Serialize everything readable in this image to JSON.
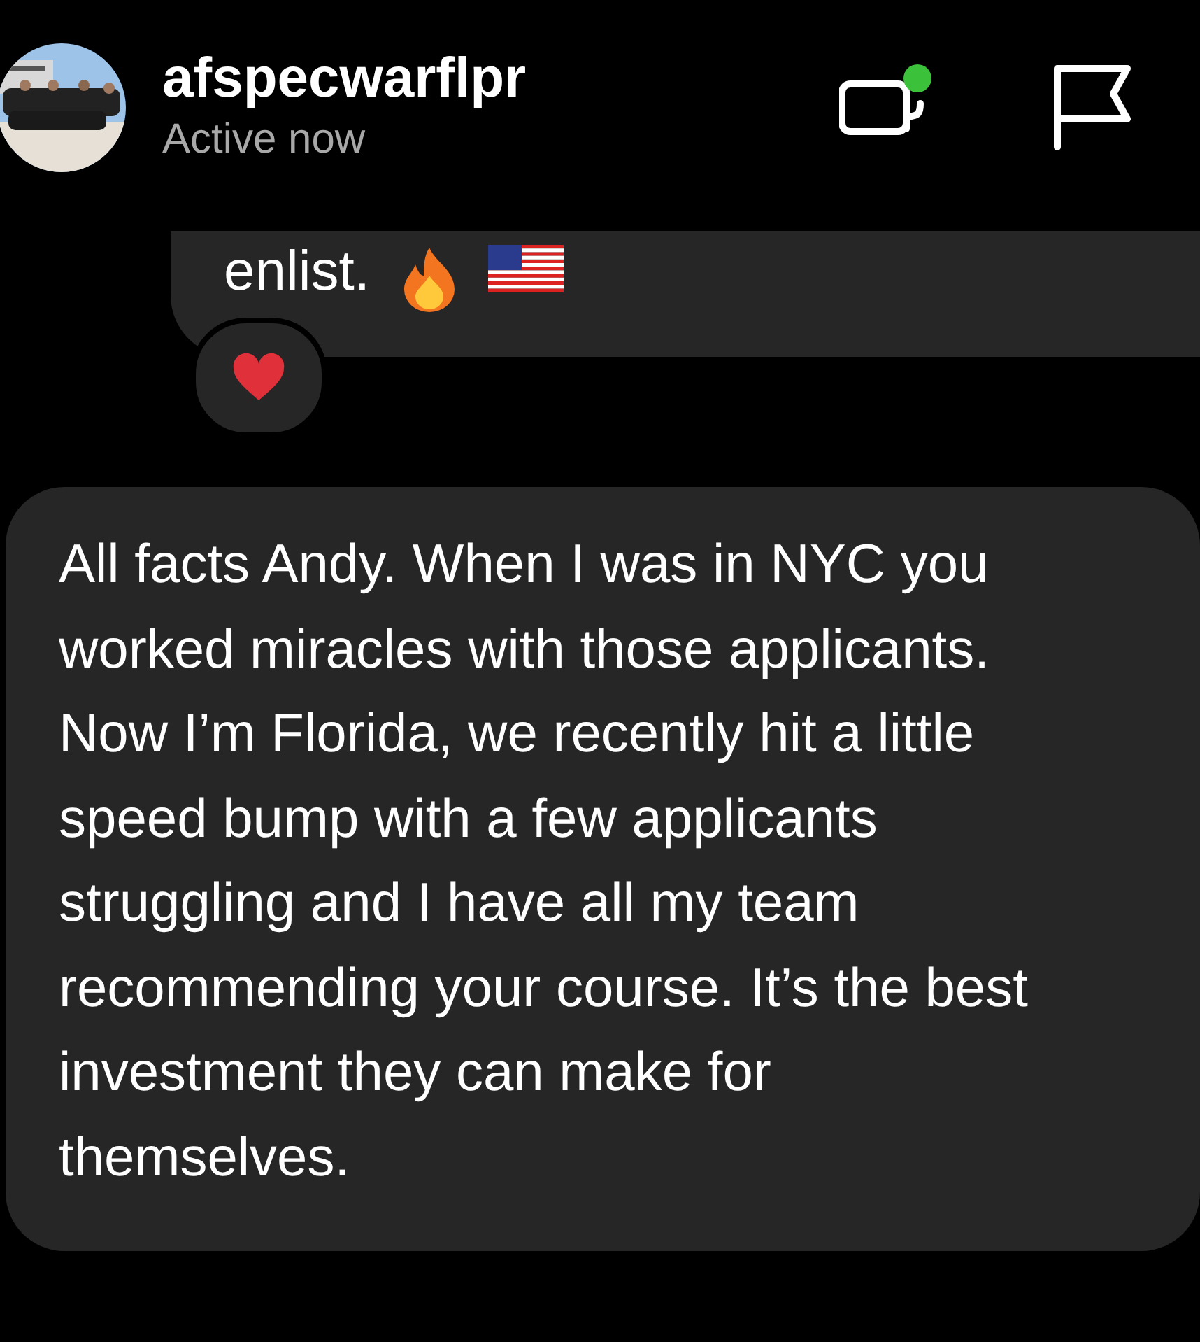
{
  "header": {
    "username": "afspecwarflpr",
    "status": "Active now"
  },
  "messages": [
    {
      "kind": "partial",
      "text": "enlist.",
      "emojis": [
        {
          "kind": "fire"
        },
        {
          "kind": "us-flag"
        }
      ],
      "reaction": {
        "kind": "heart"
      }
    },
    {
      "kind": "full",
      "text": "All facts Andy. When I was in NYC you worked miracles with those applicants. Now I’m Florida, we recently hit a little speed bump with a few applicants struggling and I have all my team recommending your course. It’s the best investment they can make for themselves."
    }
  ]
}
